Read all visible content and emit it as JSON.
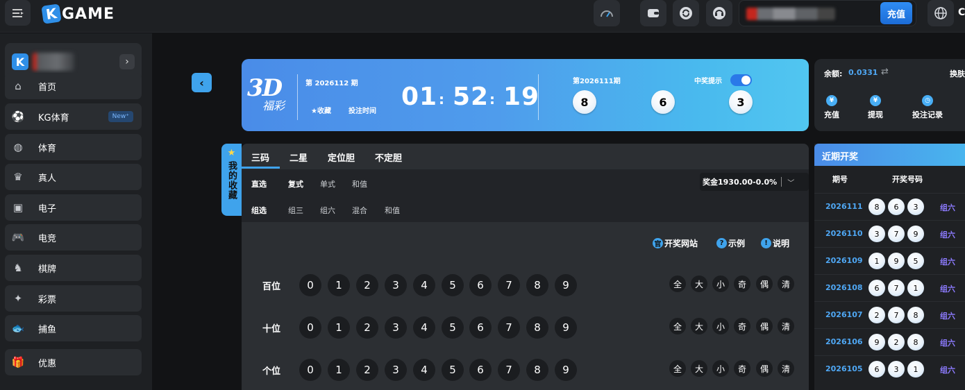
{
  "header": {
    "logo_letter": "K",
    "logo_text": "GAME",
    "recharge_label": "充值",
    "lang_text": "C"
  },
  "sidebar": {
    "items": [
      {
        "label": "首页",
        "icon": "home-icon",
        "glyph": "⌂"
      },
      {
        "label": "KG体育",
        "icon": "ball-icon",
        "glyph": "⚽",
        "badge": "New⁺"
      },
      {
        "label": "体育",
        "icon": "basketball-icon",
        "glyph": "◍"
      },
      {
        "label": "真人",
        "icon": "card-icon",
        "glyph": "♛"
      },
      {
        "label": "电子",
        "icon": "slot-icon",
        "glyph": "▣"
      },
      {
        "label": "电竞",
        "icon": "gamepad-icon",
        "glyph": "🎮"
      },
      {
        "label": "棋牌",
        "icon": "chess-icon",
        "glyph": "♞"
      },
      {
        "label": "彩票",
        "icon": "ticket-icon",
        "glyph": "✦"
      },
      {
        "label": "捕鱼",
        "icon": "fish-icon",
        "glyph": "🐟"
      },
      {
        "label": "优惠",
        "icon": "gift-icon",
        "glyph": "🎁"
      }
    ]
  },
  "banner": {
    "brand_main": "3D",
    "brand_sub": "福彩",
    "current_issue": "第 2026112 期",
    "fav_label": "★收藏",
    "bet_time_label": "投注时间",
    "countdown": {
      "h": "01",
      "m": "52",
      "s": "19"
    },
    "prev_issue": "第2026111期",
    "prev_balls": [
      "8",
      "6",
      "3"
    ],
    "notify_label": "中奖提示"
  },
  "account": {
    "balance_label": "余额:",
    "balance_value": "0.0331",
    "switch_label": "换肤",
    "actions": [
      {
        "label": "充值",
        "glyph": "¥"
      },
      {
        "label": "提现",
        "glyph": "¥"
      },
      {
        "label": "投注记录",
        "glyph": "◷"
      }
    ]
  },
  "favorites_tab": {
    "label": "我的收藏"
  },
  "game": {
    "tabs": [
      "三码",
      "二星",
      "定位胆",
      "不定胆"
    ],
    "direct_label": "直选",
    "direct_options": [
      "复式",
      "单式",
      "和值"
    ],
    "group_label": "组选",
    "group_options": [
      "组三",
      "组六",
      "混合",
      "和值"
    ],
    "prize_text": "奖金1930.00-0.0%",
    "help": [
      {
        "label": "开奖网站",
        "glyph": "官"
      },
      {
        "label": "示例",
        "glyph": "?"
      },
      {
        "label": "说明",
        "glyph": "!"
      }
    ],
    "rows": [
      "百位",
      "十位",
      "个位"
    ],
    "digits": [
      "0",
      "1",
      "2",
      "3",
      "4",
      "5",
      "6",
      "7",
      "8",
      "9"
    ],
    "quick": [
      "全",
      "大",
      "小",
      "奇",
      "偶",
      "清"
    ]
  },
  "recent": {
    "title": "近期开奖",
    "col_issue": "期号",
    "col_numbers": "开奖号码",
    "draws": [
      {
        "issue": "2026111",
        "balls": [
          "8",
          "6",
          "3"
        ],
        "type": "组六"
      },
      {
        "issue": "2026110",
        "balls": [
          "3",
          "7",
          "9"
        ],
        "type": "组六"
      },
      {
        "issue": "2026109",
        "balls": [
          "1",
          "9",
          "5"
        ],
        "type": "组六"
      },
      {
        "issue": "2026108",
        "balls": [
          "6",
          "7",
          "1"
        ],
        "type": "组六"
      },
      {
        "issue": "2026107",
        "balls": [
          "2",
          "7",
          "8"
        ],
        "type": "组六"
      },
      {
        "issue": "2026106",
        "balls": [
          "9",
          "2",
          "8"
        ],
        "type": "组六"
      },
      {
        "issue": "2026105",
        "balls": [
          "6",
          "3",
          "1"
        ],
        "type": "组六"
      }
    ]
  }
}
